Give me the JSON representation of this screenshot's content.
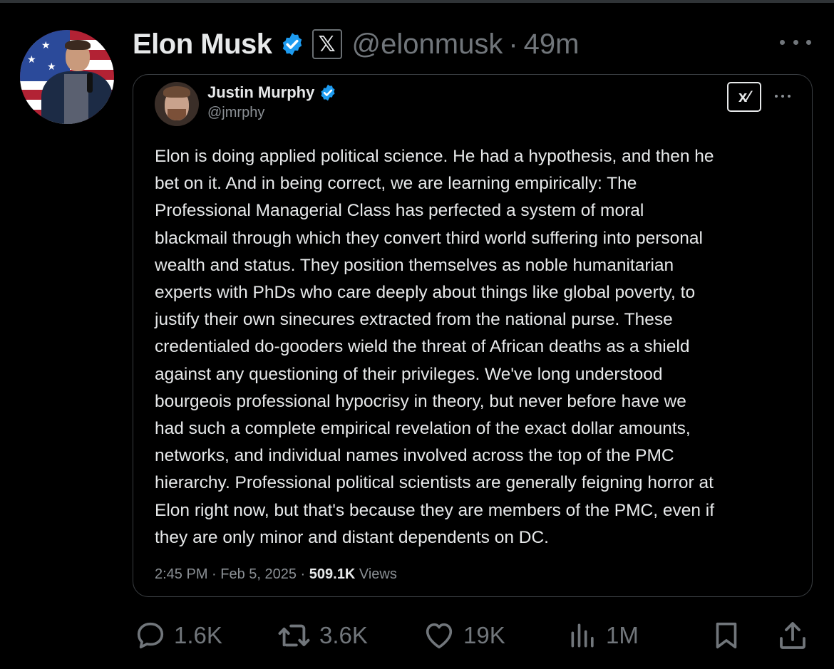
{
  "post": {
    "author_name": "Elon Musk",
    "author_handle": "@elonmusk",
    "separator": "·",
    "time_ago": "49m",
    "affiliate_badge_glyph": "𝕏",
    "verified_color": "#1d9bf0",
    "more_icon": "ellipsis-icon"
  },
  "quoted_post": {
    "author_name": "Justin Murphy",
    "author_handle": "@jmrphy",
    "grok_badge_glyph": "x⁄",
    "body_lines": [
      "Elon is doing applied political science. He had a hypothesis, and then he",
      "bet on it. And in being correct, we are learning empirically: The",
      "Professional Managerial Class has perfected a system of moral",
      "blackmail through which they convert third world suffering into personal",
      "wealth and status. They position themselves as noble humanitarian",
      "experts with PhDs who care deeply about things like global poverty, to",
      "justify their own sinecures extracted from the national purse. These",
      "credentialed do-gooders wield the threat of African deaths as a shield",
      "against any questioning of their privileges. We've long understood",
      "bourgeois professional hypocrisy in theory, but never before have we",
      "had such a complete empirical revelation of the exact dollar amounts,",
      "networks, and individual names involved across the top of the PMC",
      "hierarchy. Professional political scientists are generally feigning horror at",
      "Elon right now, but that's because they are members of the PMC, even if",
      "they are only minor and distant dependents on DC."
    ],
    "timestamp": "2:45 PM · Feb 5, 2025 · ",
    "views_count": "509.1K",
    "views_label": " Views"
  },
  "actions": {
    "replies": "1.6K",
    "reposts": "3.6K",
    "likes": "19K",
    "views": "1M"
  }
}
